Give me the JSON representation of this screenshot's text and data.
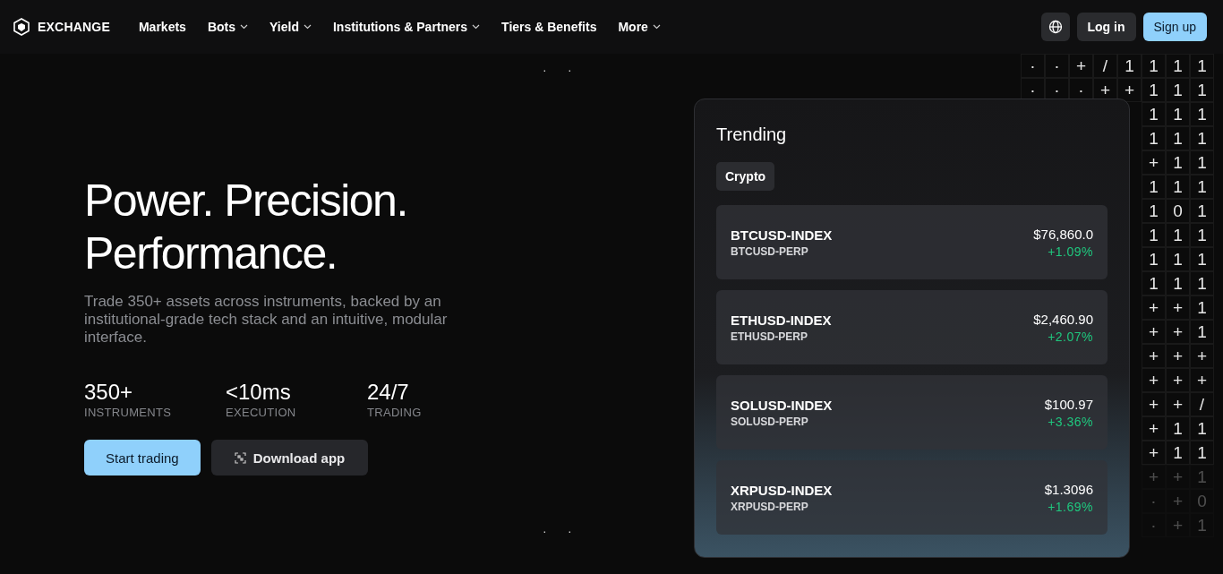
{
  "nav": {
    "brand": "EXCHANGE",
    "items": [
      {
        "label": "Markets",
        "dropdown": false
      },
      {
        "label": "Bots",
        "dropdown": true
      },
      {
        "label": "Yield",
        "dropdown": true
      },
      {
        "label": "Institutions & Partners",
        "dropdown": true
      },
      {
        "label": "Tiers & Benefits",
        "dropdown": false
      },
      {
        "label": "More",
        "dropdown": true
      }
    ],
    "login": "Log in",
    "signup": "Sign up"
  },
  "hero": {
    "title_lines": [
      "Power. Precision.",
      "Performance."
    ],
    "subtitle": "Trade 350+ assets across instruments, backed by an institutional-grade tech stack and an intuitive, modular interface.",
    "stats": [
      {
        "value": "350+",
        "label": "INSTRUMENTS"
      },
      {
        "value": "<10ms",
        "label": "EXECUTION"
      },
      {
        "value": "24/7",
        "label": "TRADING"
      }
    ],
    "primary_button": "Start trading",
    "secondary_button": "Download app"
  },
  "trending": {
    "title": "Trending",
    "tabs": [
      {
        "label": "Crypto",
        "selected": true
      }
    ],
    "rows": [
      {
        "index": "BTCUSD-INDEX",
        "perp": "BTCUSD-PERP",
        "price": "$76,860.0",
        "change": "+1.09%"
      },
      {
        "index": "ETHUSD-INDEX",
        "perp": "ETHUSD-PERP",
        "price": "$2,460.90",
        "change": "+2.07%"
      },
      {
        "index": "SOLUSD-INDEX",
        "perp": "SOLUSD-PERP",
        "price": "$100.97",
        "change": "+3.36%"
      },
      {
        "index": "XRPUSD-INDEX",
        "perp": "XRPUSD-PERP",
        "price": "$1.3096",
        "change": "+1.69%"
      }
    ]
  },
  "dots": {
    "top": [
      "·",
      "·"
    ],
    "bottom": [
      "·",
      "·"
    ]
  },
  "matrix": {
    "rows": [
      {
        "cells": [
          "·",
          "·",
          "+",
          "/",
          "1",
          "1",
          "1",
          "1"
        ],
        "faded": false
      },
      {
        "cells": [
          "·",
          "·",
          "·",
          "+",
          "+",
          "1",
          "1",
          "1"
        ],
        "faded": false
      },
      {
        "cells": [
          "1",
          "1",
          "1"
        ],
        "faded": false
      },
      {
        "cells": [
          "1",
          "1",
          "1"
        ],
        "faded": false
      },
      {
        "cells": [
          "+",
          "1",
          "1"
        ],
        "faded": false
      },
      {
        "cells": [
          "1",
          "1",
          "1"
        ],
        "faded": false
      },
      {
        "cells": [
          "1",
          "0",
          "1"
        ],
        "faded": false
      },
      {
        "cells": [
          "1",
          "1",
          "1"
        ],
        "faded": false
      },
      {
        "cells": [
          "1",
          "1",
          "1"
        ],
        "faded": false
      },
      {
        "cells": [
          "1",
          "1",
          "1"
        ],
        "faded": false
      },
      {
        "cells": [
          "+",
          "+",
          "1"
        ],
        "faded": false
      },
      {
        "cells": [
          "+",
          "+",
          "1"
        ],
        "faded": false
      },
      {
        "cells": [
          "+",
          "+",
          "+"
        ],
        "faded": false
      },
      {
        "cells": [
          "+",
          "+",
          "+"
        ],
        "faded": false
      },
      {
        "cells": [
          "+",
          "+",
          "/"
        ],
        "faded": false
      },
      {
        "cells": [
          "+",
          "1",
          "1"
        ],
        "faded": false
      },
      {
        "cells": [
          "+",
          "1",
          "1"
        ],
        "faded": false
      },
      {
        "cells": [
          "+",
          "+",
          "1"
        ],
        "faded": true
      },
      {
        "cells": [
          "·",
          "+",
          "0"
        ],
        "faded": true
      },
      {
        "cells": [
          "·",
          "+",
          "1"
        ],
        "faded": true
      }
    ]
  }
}
